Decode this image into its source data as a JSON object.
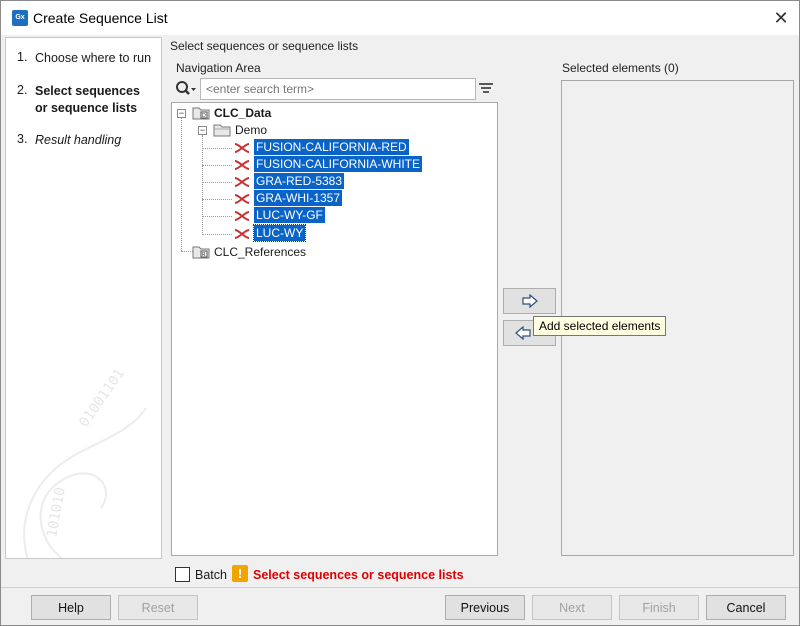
{
  "window": {
    "title": "Create Sequence List",
    "app_icon": "clc-app-icon",
    "close_symbol": "✕"
  },
  "steps": [
    {
      "num": "1.",
      "label": "Choose where to run",
      "state": "done"
    },
    {
      "num": "2.",
      "label": "Select sequences or sequence lists",
      "state": "active"
    },
    {
      "num": "3.",
      "label": "Result handling",
      "state": "future"
    }
  ],
  "main": {
    "section_title": "Select sequences or sequence lists",
    "navigation_label": "Navigation Area",
    "selected_label": "Selected elements (0)",
    "search": {
      "value": "",
      "placeholder": "<enter search term>"
    }
  },
  "tree": {
    "root": "CLC_Data",
    "folder": "Demo",
    "sequences": [
      "FUSION-CALIFORNIA-RED",
      "FUSION-CALIFORNIA-WHITE",
      "GRA-RED-5383",
      "GRA-WHI-1357",
      "LUC-WY-GF",
      "LUC-WY"
    ],
    "references": "CLC_References"
  },
  "tooltip": "Add selected elements",
  "batch": {
    "label": "Batch",
    "checked": false
  },
  "warning": "Select sequences or sequence lists",
  "buttons": {
    "help": "Help",
    "reset": "Reset",
    "previous": "Previous",
    "next": "Next",
    "finish": "Finish",
    "cancel": "Cancel"
  },
  "colors": {
    "selection": "#0a64c8",
    "warning_text": "#e00000",
    "tooltip_bg": "#ffffe1",
    "sequence_icon": "#c83232"
  }
}
